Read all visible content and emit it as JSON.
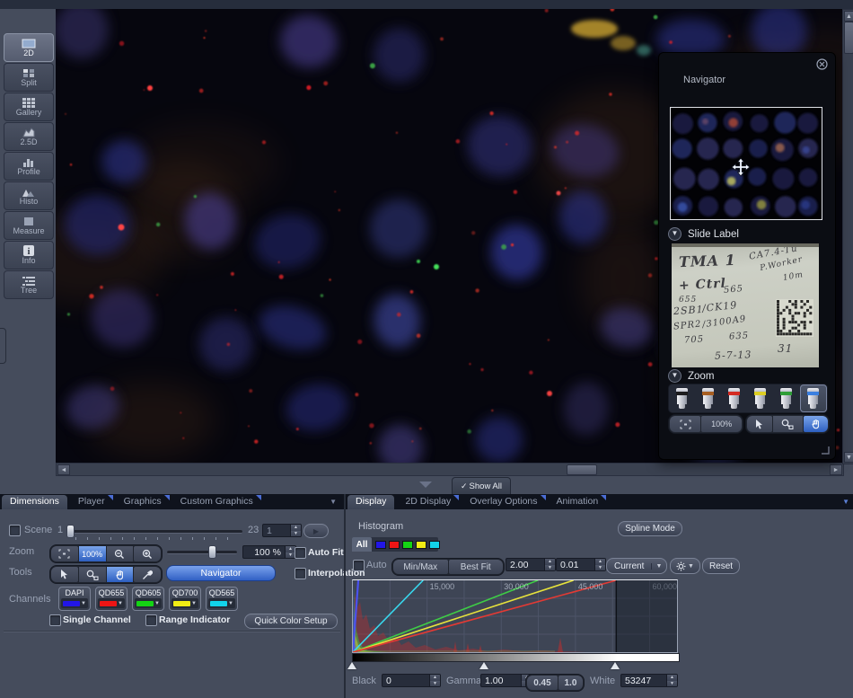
{
  "sidebar": {
    "items": [
      {
        "label": "2D"
      },
      {
        "label": "Split"
      },
      {
        "label": "Gallery"
      },
      {
        "label": "2.5D"
      },
      {
        "label": "Profile"
      },
      {
        "label": "Histo"
      },
      {
        "label": "Measure"
      },
      {
        "label": "Info"
      },
      {
        "label": "Tree"
      }
    ]
  },
  "navigator": {
    "title": "Navigator",
    "slide_label_section": "Slide Label",
    "zoom_section": "Zoom",
    "zoom_percent": "100%",
    "objective_colors": [
      "#1c1c1e",
      "#a85f22",
      "#d42a22",
      "#ddce24",
      "#2f9e38",
      "#3b7fe0"
    ],
    "slide_label_lines": [
      {
        "t": "TMA 1",
        "x": 8,
        "y": 6,
        "s": 16,
        "r": -2,
        "w": "bold"
      },
      {
        "t": "CA7.4-Tu",
        "x": 86,
        "y": 1,
        "s": 10,
        "r": -10
      },
      {
        "t": "P.Worker",
        "x": 98,
        "y": 14,
        "s": 9,
        "r": -12
      },
      {
        "t": "10m",
        "x": 124,
        "y": 28,
        "s": 9,
        "r": -10
      },
      {
        "t": "+ Ctrl",
        "x": 8,
        "y": 34,
        "s": 14,
        "r": -3,
        "w": "bold"
      },
      {
        "t": "565",
        "x": 58,
        "y": 42,
        "s": 10,
        "r": -5
      },
      {
        "t": "655",
        "x": 8,
        "y": 54,
        "s": 9,
        "r": 0
      },
      {
        "t": "2SB1",
        "x": 2,
        "y": 64,
        "s": 11,
        "r": -4
      },
      {
        "t": "/CK19",
        "x": 34,
        "y": 60,
        "s": 11,
        "r": -6
      },
      {
        "t": "SPR2",
        "x": 2,
        "y": 82,
        "s": 10,
        "r": -6
      },
      {
        "t": "/3100A9",
        "x": 34,
        "y": 78,
        "s": 10,
        "r": -8
      },
      {
        "t": "705",
        "x": 14,
        "y": 98,
        "s": 10,
        "r": -3
      },
      {
        "t": "635",
        "x": 64,
        "y": 94,
        "s": 10,
        "r": -3
      },
      {
        "t": "5-7-13",
        "x": 48,
        "y": 114,
        "s": 11,
        "r": -2
      },
      {
        "t": "31",
        "x": 118,
        "y": 106,
        "s": 12,
        "r": 0
      }
    ]
  },
  "show_all": {
    "check": "✓",
    "label": "Show All"
  },
  "left_panel": {
    "tabs": [
      {
        "label": "Dimensions",
        "active": true
      },
      {
        "label": "Player"
      },
      {
        "label": "Graphics"
      },
      {
        "label": "Custom Graphics"
      }
    ],
    "scene": {
      "label": "Scene",
      "start": "1",
      "end": "23",
      "value": "1"
    },
    "zoom": {
      "label": "Zoom",
      "fit_label": "100%",
      "value": "100 %",
      "auto_fit": "Auto Fit"
    },
    "tools": {
      "label": "Tools",
      "navigator_button": "Navigator",
      "interpolation": "Interpolation"
    },
    "channels": {
      "label": "Channels",
      "items": [
        {
          "name": "DAPI",
          "color": "#2216e6"
        },
        {
          "name": "QD655",
          "color": "#ed1515"
        },
        {
          "name": "QD605",
          "color": "#14d414"
        },
        {
          "name": "QD700",
          "color": "#f0ec14"
        },
        {
          "name": "QD565",
          "color": "#12d2ea"
        }
      ],
      "single_channel": "Single Channel",
      "range_indicator": "Range Indicator",
      "quick_color_setup": "Quick Color Setup"
    }
  },
  "right_panel": {
    "tabs": [
      {
        "label": "Display",
        "active": true
      },
      {
        "label": "2D Display"
      },
      {
        "label": "Overlay Options"
      },
      {
        "label": "Animation"
      }
    ],
    "histogram_title": "Histogram",
    "spline_mode": "Spline Mode",
    "all_tab": "All",
    "controls": {
      "auto": "Auto",
      "min_max": "Min/Max",
      "best_fit": "Best Fit",
      "value1": "2.00",
      "value2": "0.01",
      "dropdown": "Current",
      "reset": "Reset"
    },
    "levels": {
      "black_label": "Black",
      "black": "0",
      "gamma_label": "Gamma",
      "gamma": "1.00",
      "gamma_045": "0.45",
      "gamma_10": "1.0",
      "white_label": "White",
      "white": "53247"
    },
    "histogram": {
      "type": "histogram+line",
      "x_max": 65535,
      "x_ticks": [
        {
          "value": 15000,
          "label": "15,000"
        },
        {
          "value": 30000,
          "label": "30,000"
        },
        {
          "value": 45000,
          "label": "45,000"
        },
        {
          "value": 60000,
          "label": "60,000"
        }
      ],
      "minor_grid_step": 7500,
      "lines": [
        {
          "name": "DAPI",
          "color": "#4a52f0",
          "top_value": 1100
        },
        {
          "name": "QD565",
          "color": "#38d8ee",
          "top_value": 14200
        },
        {
          "name": "QD605",
          "color": "#3ecc46",
          "top_value": 37400
        },
        {
          "name": "QD700",
          "color": "#e6e23c",
          "top_value": 44600
        },
        {
          "name": "QD655",
          "color": "#e23a34",
          "top_value": 53247
        }
      ],
      "black_point": 0,
      "gamma_value": 1.0,
      "white_point": 53247
    }
  }
}
